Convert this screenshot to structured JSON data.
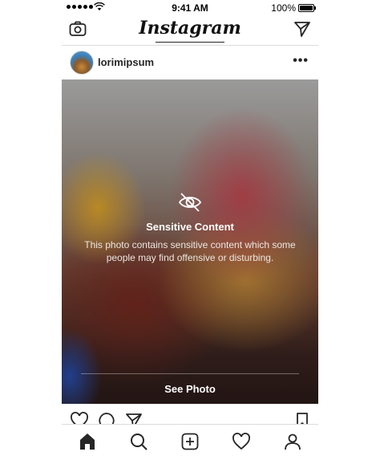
{
  "status_bar": {
    "time": "9:41 AM",
    "battery": "100%"
  },
  "nav": {
    "brand": "Instagram",
    "camera_icon": "camera-icon",
    "send_icon": "paper-plane-icon"
  },
  "post": {
    "username": "lorimipsum",
    "more_label": "•••",
    "sensitive": {
      "icon": "eye-slash-icon",
      "title": "Sensitive Content",
      "description": "This photo contains sensitive content which some people may find offensive or disturbing.",
      "see_photo_label": "See Photo"
    },
    "actions": [
      "heart-icon",
      "comment-icon",
      "share-icon",
      "bookmark-icon"
    ]
  },
  "tab_bar": [
    "home-icon",
    "search-icon",
    "add-post-icon",
    "activity-heart-icon",
    "profile-icon"
  ]
}
